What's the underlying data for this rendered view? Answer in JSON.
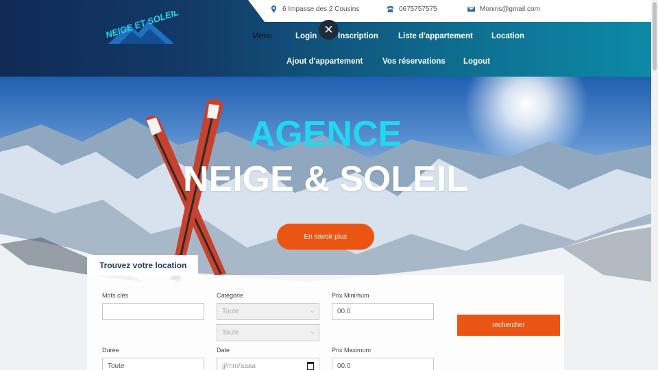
{
  "contact": {
    "address": "6 Impasse des 2 Cousins",
    "phone": "0675757575",
    "email": "Moniris@gmail.com"
  },
  "logo": {
    "text": "NEIGE ET SOLEIL"
  },
  "nav": {
    "menu_label": "Menu",
    "items": [
      "Login",
      "Inscription",
      "Liste d'appartement",
      "Location",
      "Ajout d'appartement",
      "Vos réservations",
      "Logout"
    ],
    "close_symbol": "✕"
  },
  "hero": {
    "title_line1": "AGENCE",
    "title_line2": "NEIGE & SOLEIL",
    "cta_label": "En savoir plus"
  },
  "search": {
    "tab_label": "Trouvez votre location",
    "keywords": {
      "label": "Mots clés",
      "value": ""
    },
    "category": {
      "label": "Catégorie",
      "value": "Toute",
      "sub_value": "Toute"
    },
    "price_min": {
      "label": "Prix Minimum",
      "value": "00.0"
    },
    "duration": {
      "label": "Durée",
      "value": "Toute"
    },
    "date": {
      "label": "Date",
      "placeholder": "jj/mm/aaaa"
    },
    "price_max": {
      "label": "Prix Maximum",
      "value": "00.0"
    },
    "submit_label": "rechercher"
  },
  "colors": {
    "accent": "#ea5514",
    "title_cyan": "#22d8f0",
    "header_dark": "#0f2a55",
    "header_teal": "#0d8aa6"
  },
  "icons": [
    "location-pin-icon",
    "phone-icon",
    "envelope-icon",
    "close-icon",
    "chevron-down-icon",
    "calendar-icon"
  ]
}
